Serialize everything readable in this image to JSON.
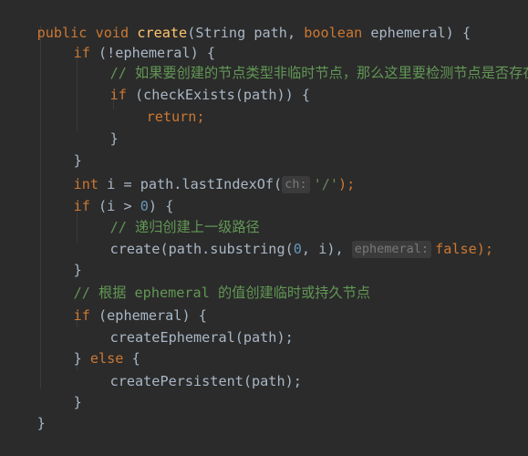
{
  "code": {
    "l1": {
      "kw1": "public",
      "kw2": "void",
      "name": "create",
      "p1": "(String path, ",
      "kw3": "boolean",
      "p2": " ephemeral) {"
    },
    "l2": {
      "kw": "if",
      "rest": " (!ephemeral) {"
    },
    "l3": {
      "comment": "// 如果要创建的节点类型非临时节点，那么这里要检测节点是否存在"
    },
    "l4": {
      "kw": "if",
      "rest": " (checkExists(path)) {"
    },
    "l5": {
      "kw": "return",
      "semi": ";"
    },
    "l6": {
      "text": "}"
    },
    "l7": {
      "text": "}"
    },
    "l8": {
      "kw": "int",
      "pre": " i = path.lastIndexOf(",
      "hint": "ch:",
      "str": "'/'",
      "post": ");"
    },
    "l9": {
      "kw": "if",
      "pre": " (i > ",
      "num": "0",
      "post": ") {"
    },
    "l10": {
      "comment": "// 递归创建上一级路径"
    },
    "l11": {
      "pre": "create(path.substring(",
      "num": "0",
      "mid": ", i), ",
      "hint": "ephemeral:",
      "kw": "false",
      "post": ");"
    },
    "l12": {
      "text": "}"
    },
    "l13": {
      "comment": "// 根据 ephemeral 的值创建临时或持久节点"
    },
    "l14": {
      "kw": "if",
      "rest": " (ephemeral) {"
    },
    "l15": {
      "text": "createEphemeral(path);"
    },
    "l16": {
      "pre": "} ",
      "kw": "else",
      "post": " {"
    },
    "l17": {
      "text": "createPersistent(path);"
    },
    "l18": {
      "text": "}"
    },
    "l19": {
      "text": "}"
    }
  }
}
